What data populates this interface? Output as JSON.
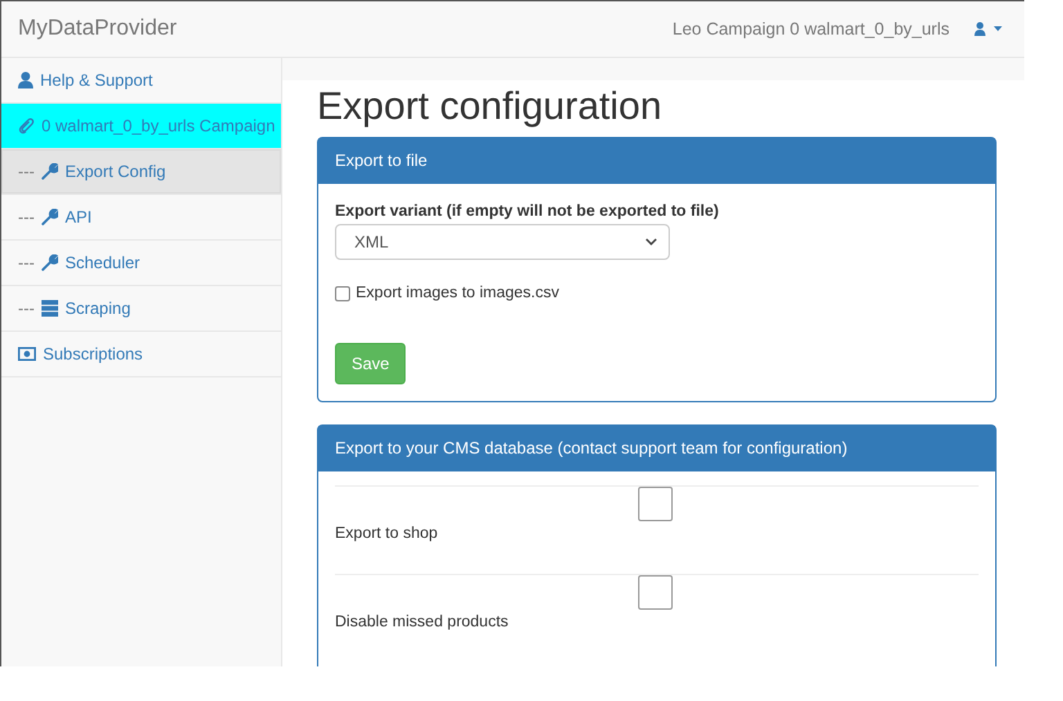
{
  "navbar": {
    "brand": "MyDataProvider",
    "user_label": "Leo Campaign 0 walmart_0_by_urls"
  },
  "sidebar": {
    "items": [
      {
        "kind": "account",
        "label": "Help & Support",
        "selected": false,
        "highlighted": false
      },
      {
        "kind": "campaign",
        "label": "0 walmart_0_by_urls Campaign",
        "selected": false,
        "highlighted": true
      },
      {
        "kind": "setting",
        "prefix": "---",
        "label": "Export Config",
        "selected": true,
        "highlighted": false
      },
      {
        "kind": "setting",
        "prefix": "---",
        "label": "API",
        "selected": false,
        "highlighted": false
      },
      {
        "kind": "setting",
        "prefix": "---",
        "label": "Scheduler",
        "selected": false,
        "highlighted": false
      },
      {
        "kind": "data",
        "prefix": "---",
        "label": "Scraping",
        "selected": false,
        "highlighted": false
      },
      {
        "kind": "billing",
        "label": "Subscriptions",
        "selected": false,
        "highlighted": false
      }
    ]
  },
  "page_title": "Export configuration",
  "file_panel": {
    "heading": "Export to file",
    "variant_label": "Export variant (if empty will not be exported to file)",
    "variant_value": "XML",
    "images_checkbox": {
      "label": "Export images to images.csv",
      "checked": false
    },
    "save_button": "Save"
  },
  "cms_panel": {
    "heading": "Export to your CMS database (contact support team for configuration)",
    "rows": [
      {
        "label": "Export to shop",
        "checked": false
      },
      {
        "label": "Disable missed products",
        "checked": false
      }
    ]
  }
}
